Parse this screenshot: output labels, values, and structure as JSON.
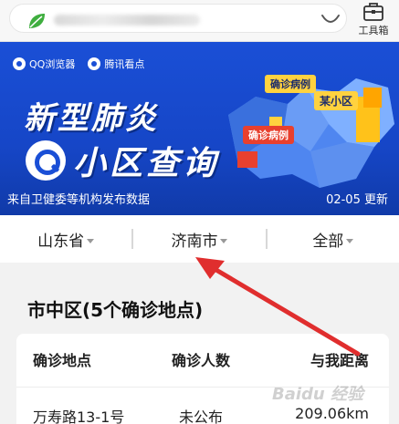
{
  "toolbar": {
    "toolbox_label": "工具箱"
  },
  "banner": {
    "brand_qq": "QQ浏览器",
    "brand_news": "腾讯看点",
    "title_line1": "新型肺炎",
    "title_line2": "小区查询",
    "source": "来自卫健委等机构发布数据",
    "update": "02-05 更新",
    "map_tags": {
      "confirmed_1": "确诊病例",
      "community": "某小区",
      "confirmed_2": "确诊病例"
    }
  },
  "filters": [
    {
      "label": "山东省"
    },
    {
      "label": "济南市"
    },
    {
      "label": "全部"
    }
  ],
  "district": {
    "title": "市中区(5个确诊地点)"
  },
  "table": {
    "headers": [
      "确诊地点",
      "确诊人数",
      "与我距离"
    ],
    "rows": [
      [
        "万寿路13-1号",
        "未公布",
        "209.06km"
      ]
    ]
  },
  "watermark": "Baidu 经验",
  "colors": {
    "banner_blue": "#1a4fd6",
    "arrow_red": "#e02e2e",
    "tag_yellow": "#ffd23f",
    "tag_red": "#e8402e"
  }
}
